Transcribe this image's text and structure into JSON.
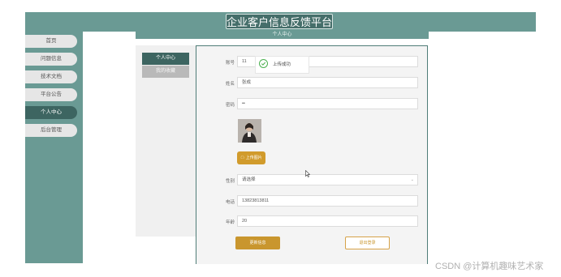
{
  "header": {
    "title": "企业客户信息反馈平台"
  },
  "sidebar": {
    "items": [
      {
        "label": "首页"
      },
      {
        "label": "问题信息"
      },
      {
        "label": "技术文档"
      },
      {
        "label": "平台公告"
      },
      {
        "label": "个人中心",
        "active": true
      },
      {
        "label": "后台管理"
      }
    ]
  },
  "page": {
    "subtitle": "个人中心",
    "left_menu": {
      "personal": "个人中心",
      "favorites": "我的收藏"
    }
  },
  "toast": {
    "text": "上传成功"
  },
  "form": {
    "account": {
      "label": "账号",
      "value": "11"
    },
    "name": {
      "label": "姓名",
      "value": "张成"
    },
    "password": {
      "label": "密码",
      "value": "••"
    },
    "upload_button": "上传图片",
    "gender": {
      "label": "性别",
      "value": "请选择"
    },
    "phone": {
      "label": "电话",
      "value": "13823813811"
    },
    "age": {
      "label": "年龄",
      "value": "20"
    },
    "update_button": "更新信息",
    "logout_button": "退出登录"
  },
  "watermark": "CSDN @计算机趣味艺术家",
  "colors": {
    "primary": "#6a9a94",
    "dark": "#3d6561",
    "accent": "#d19b2c",
    "success": "#4cb050"
  }
}
